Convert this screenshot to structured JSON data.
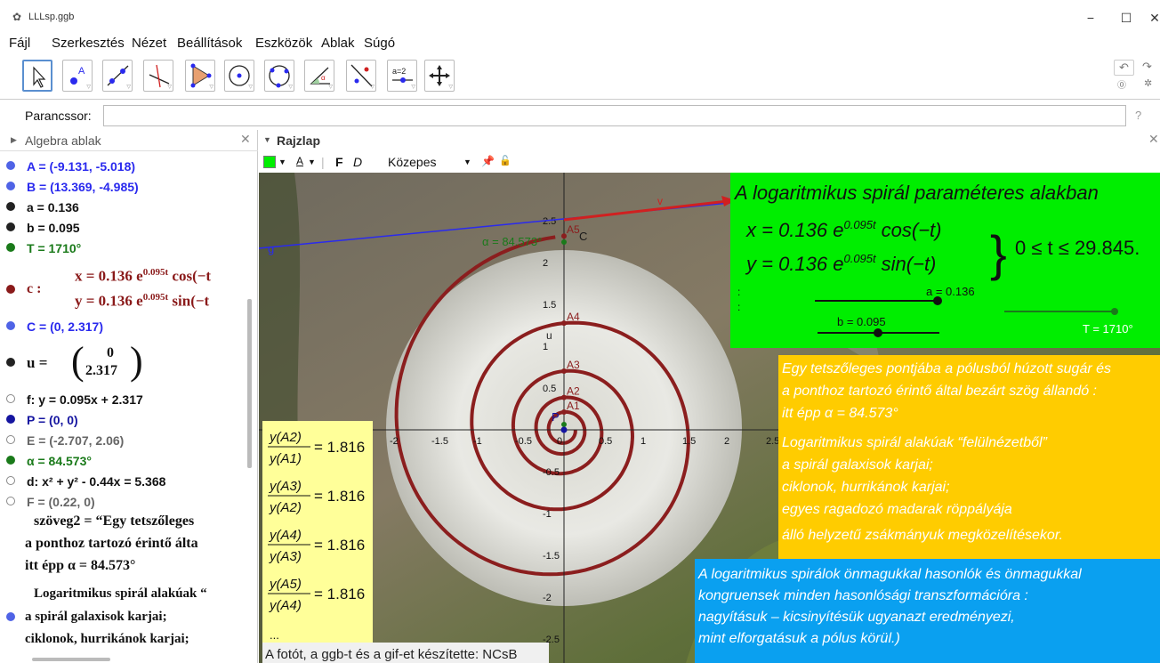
{
  "window": {
    "title": "LLLsp.ggb",
    "minimize": "−",
    "maximize": "☐",
    "close": "✕"
  },
  "menu": [
    "Fájl",
    "Szerkesztés",
    "Nézet",
    "Beállítások",
    "Eszközök",
    "Ablak",
    "Súgó"
  ],
  "toolbar": {
    "tools": [
      "move-tool",
      "point-tool",
      "line-tool",
      "perpendicular-tool",
      "polygon-tool",
      "circle-tool",
      "circle-three-points-tool",
      "angle-tool",
      "reflect-tool",
      "slider-tool",
      "move-view-tool"
    ],
    "slider_label": "a=2"
  },
  "command": {
    "label": "Parancssor:",
    "value": "",
    "help": "?"
  },
  "algebra": {
    "title": "Algebra ablak",
    "rows": [
      {
        "text": "A = (-9.131, -5.018)",
        "color": "blue",
        "hollow": false
      },
      {
        "text": "B = (13.369, -4.985)",
        "color": "blue",
        "hollow": false
      },
      {
        "text": "a = 0.136",
        "color": "black",
        "hollow": false
      },
      {
        "text": "b = 0.095",
        "color": "black",
        "hollow": false
      },
      {
        "text": "T = 1710°",
        "color": "green",
        "hollow": false
      },
      {
        "text": "C = (0, 2.317)",
        "color": "blue",
        "hollow": false
      },
      {
        "text": "f: y = 0.095x + 2.317",
        "color": "grey",
        "hollow": true
      },
      {
        "text": "P = (0, 0)",
        "color": "dblue",
        "hollow": false
      },
      {
        "text": "E = (-2.707, 2.06)",
        "color": "grey",
        "hollow": true
      },
      {
        "text": "α = 84.573°",
        "color": "green",
        "hollow": false
      },
      {
        "text": "d: x² + y² - 0.44x = 5.368",
        "color": "grey",
        "hollow": true
      },
      {
        "text": "F = (0.22, 0)",
        "color": "grey",
        "hollow": true
      }
    ],
    "curve": {
      "label": "c :",
      "line1": "x = 0.136 e",
      "line1b": "cos(−t",
      "line2": "y = 0.136 e",
      "line2b": "sin(−t",
      "exp": "0.095t"
    },
    "vector": {
      "label": "u =",
      "top": "0",
      "bottom": "2.317"
    },
    "text_rows": [
      "szöveg2 = “Egy tetszőleges",
      "a ponthoz tartozó érintő álta",
      "itt épp α = 84.573°",
      "Logaritmikus spirál alakúak “",
      "a spirál galaxisok karjai;",
      "ciklonok,  hurrikánok karjai;"
    ]
  },
  "graphics": {
    "title": "Rajzlap",
    "stylebar": {
      "bold": "F",
      "italic": "D",
      "size": "Közepes"
    },
    "axis_x_ticks": [
      "-2",
      "-1.5",
      "-1",
      "-0.5",
      "0",
      "0.5",
      "1",
      "1.5",
      "2",
      "2.5"
    ],
    "axis_y_ticks": [
      "2.5",
      "2",
      "1.5",
      "1",
      "0.5",
      "-0.5",
      "-1",
      "-1.5",
      "-2",
      "-2.5"
    ],
    "point_labels": [
      "A5",
      "A4",
      "A3",
      "A2",
      "A1",
      "P",
      "C"
    ],
    "labels": {
      "vector_v": "v",
      "line_g": "g",
      "vector_u": "u",
      "angle": "α = 84.573°"
    },
    "green_box": {
      "title": "A logaritmikus spirál paraméteres alakban",
      "x_eq": "x = 0.136 e",
      "y_eq": "y = 0.136 e",
      "exp": "0.095t",
      "x_trig": "cos(−t)",
      "y_trig": "sin(−t)",
      "range": "0 ≤ t ≤ 29.845.",
      "slider_a": "a = 0.136",
      "slider_b": "b = 0.095",
      "slider_T": "T = 1710°"
    },
    "yellow_box": {
      "ratio_value": "= 1.816",
      "ratios": [
        [
          "y(A2)",
          "y(A1)"
        ],
        [
          "y(A3)",
          "y(A2)"
        ],
        [
          "y(A4)",
          "y(A3)"
        ],
        [
          "y(A5)",
          "y(A4)"
        ]
      ],
      "ellipsis": "..."
    },
    "orange_box": [
      "Egy tetszőleges pontjába a pólusból húzott sugár és",
      "a ponthoz tartozó érintő által bezárt szög állandó :",
      "itt épp α = 84.573°",
      "Logaritmikus spirál alakúak “felülnézetből”",
      "a spirál galaxisok karjai;",
      "ciklonok, hurrikánok karjai;",
      "egyes ragadozó madarak röppályája",
      "álló helyzetű zsákmányuk megközelítésekor."
    ],
    "blue_box": [
      "A logaritmikus spirálok önmagukkal hasonlók és önmagukkal",
      "kongruensek minden hasonlósági transzformációra :",
      "nagyításuk – kicsinyítésük ugyanazt eredményezi,",
      "mint elforgatásuk a pólus körül.)"
    ],
    "credit": "A fotót, a ggb-t és a gif-et készítette: NCsB"
  },
  "colors": {
    "spiral": "#8b1e1e",
    "green_box": "#00ee00",
    "orange_box": "#ffcc00",
    "blue_box": "#0aa0f0",
    "yellow_box": "#ffff99",
    "axis": "#222222",
    "line_g": "#2a2aee"
  }
}
